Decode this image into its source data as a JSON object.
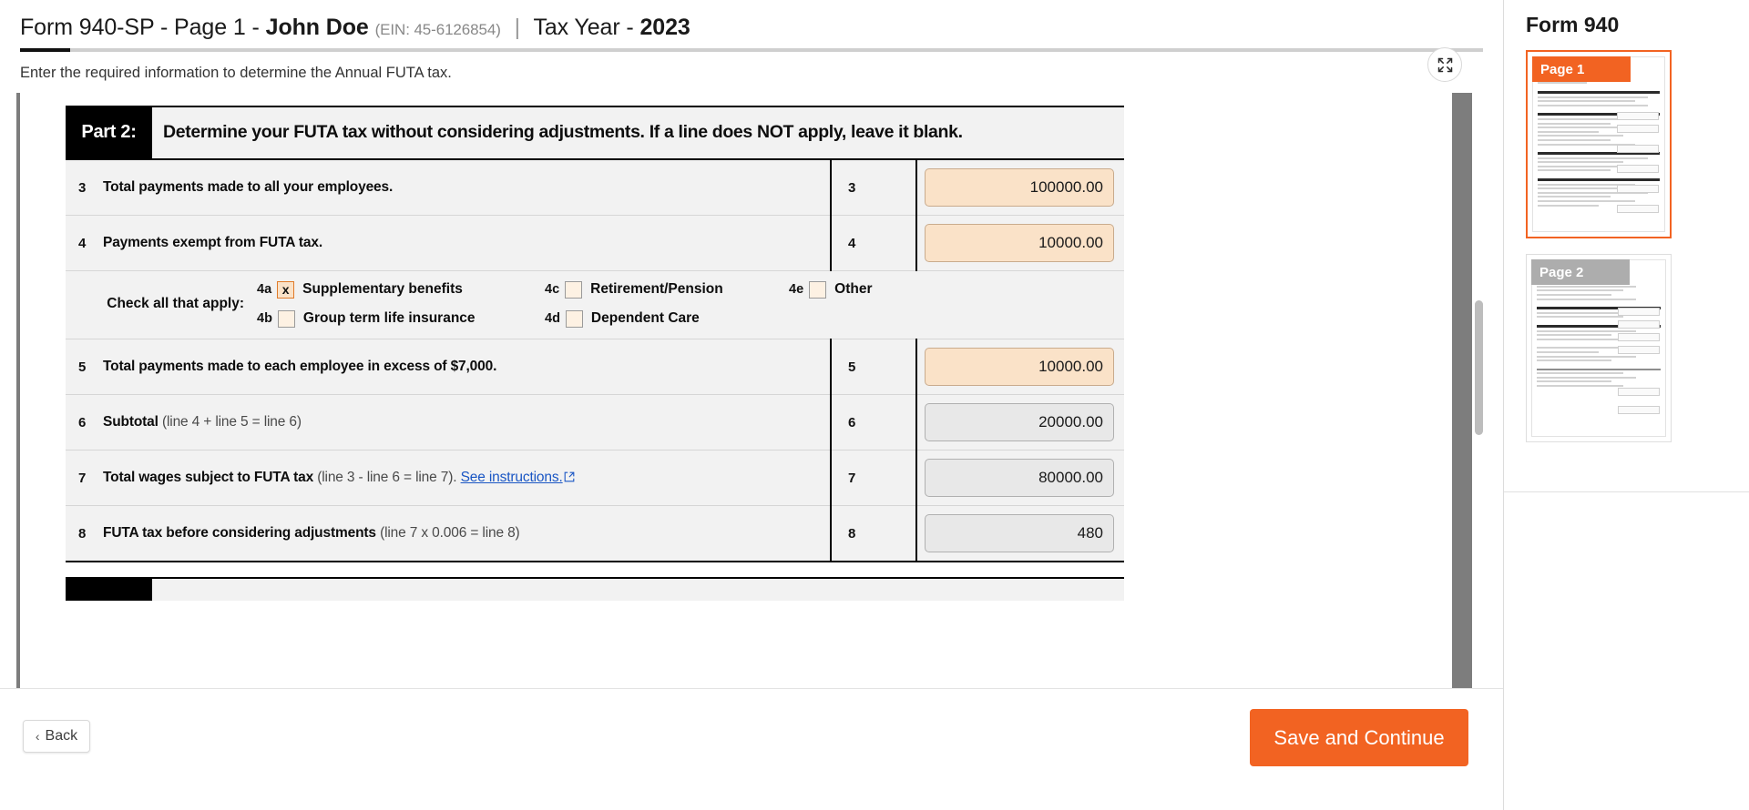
{
  "header": {
    "form_prefix": "Form 940-SP - Page",
    "page_number": "1",
    "dash": "-",
    "taxpayer_name": "John Doe",
    "ein_label": "(EIN: 45-6126854)",
    "separator": "|",
    "tax_year_label": "Tax Year -",
    "tax_year": "2023",
    "subtitle": "Enter the required information to determine the Annual FUTA tax.",
    "expand_icon": "expand-collapse-icon"
  },
  "part": {
    "tag": "Part 2:",
    "heading": "Determine your FUTA tax without considering adjustments. If a line does NOT apply, leave it blank."
  },
  "rows": [
    {
      "num": "3",
      "label": "Total payments made to all your employees.",
      "sub": "",
      "line_num": "3",
      "value": "100000.00",
      "field_state": "editable"
    },
    {
      "num": "4",
      "label": "Payments exempt from FUTA tax.",
      "sub": "",
      "line_num": "4",
      "value": "10000.00",
      "field_state": "editable"
    },
    {
      "num": "5",
      "label": "Total payments made to each employee in excess of $7,000.",
      "sub": "",
      "line_num": "5",
      "value": "10000.00",
      "field_state": "editable"
    },
    {
      "num": "6",
      "label": "Subtotal",
      "sub": "(line 4 + line 5 = line 6)",
      "line_num": "6",
      "value": "20000.00",
      "field_state": "readonly"
    },
    {
      "num": "7",
      "label": "Total wages subject to FUTA tax",
      "sub": "(line 3 - line 6 = line 7).",
      "link": "See instructions.",
      "link_icon": "external-link-icon",
      "line_num": "7",
      "value": "80000.00",
      "field_state": "readonly"
    },
    {
      "num": "8",
      "label": "FUTA tax before considering adjustments",
      "sub": "(line 7 x 0.006 = line 8)",
      "line_num": "8",
      "value": "480",
      "field_state": "readonly"
    }
  ],
  "checkbox_group": {
    "caption": "Check all that apply:",
    "items": [
      {
        "code": "4a",
        "label": "Supplementary benefits",
        "checked": true,
        "mark": "x"
      },
      {
        "code": "4b",
        "label": "Group term life insurance",
        "checked": false,
        "mark": ""
      },
      {
        "code": "4c",
        "label": "Retirement/Pension",
        "checked": false,
        "mark": ""
      },
      {
        "code": "4d",
        "label": "Dependent Care",
        "checked": false,
        "mark": ""
      },
      {
        "code": "4e",
        "label": "Other",
        "checked": false,
        "mark": ""
      }
    ]
  },
  "footer": {
    "back_label": "Back",
    "back_chevron": "chevron-left-icon",
    "save_label": "Save and Continue"
  },
  "sidebar": {
    "title": "Form 940",
    "pages": [
      {
        "label": "Page 1",
        "selected": true
      },
      {
        "label": "Page 2",
        "selected": false
      }
    ]
  },
  "colors": {
    "accent_orange": "#f26322",
    "editable_field": "#fae2c8",
    "readonly_field": "#e8e8e8",
    "link_blue": "#1a56c4",
    "banner_black": "#000000"
  }
}
